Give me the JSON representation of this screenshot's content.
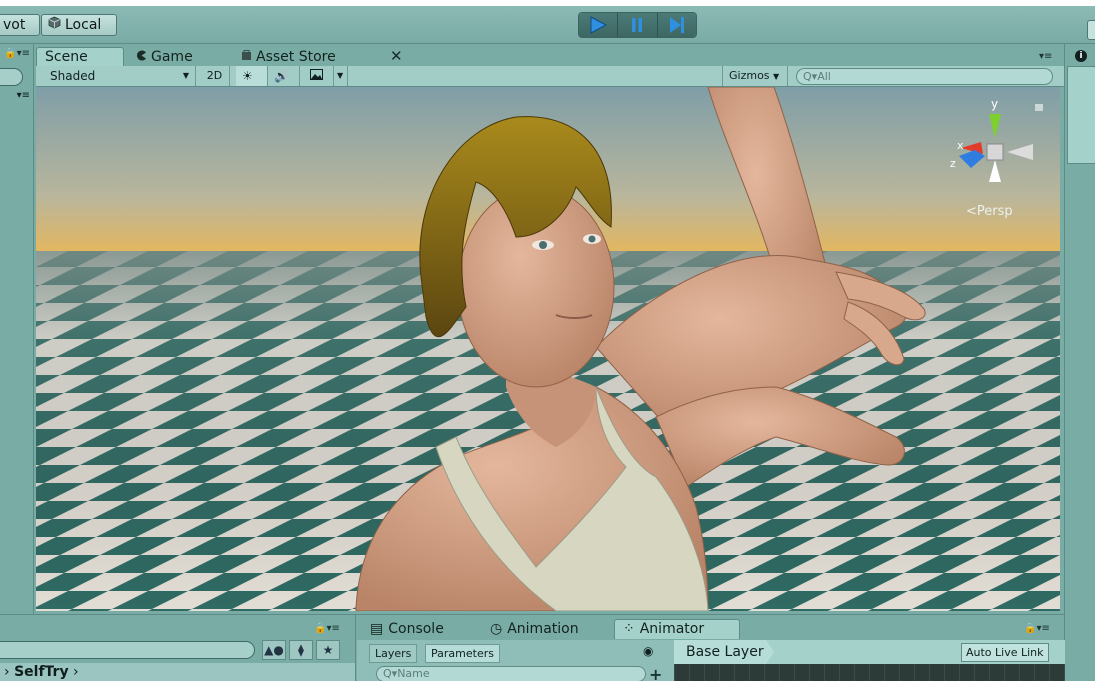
{
  "toolbar": {
    "pivot_label": "vot",
    "local_label": "Local",
    "local_icon": "cube-icon",
    "play_icon": "play-icon",
    "pause_icon": "pause-icon",
    "step_icon": "step-icon"
  },
  "scene_panel": {
    "tabs": [
      {
        "label": "Scene",
        "icon": ""
      },
      {
        "label": "Game",
        "icon": "pacman-icon"
      },
      {
        "label": "Asset Store",
        "icon": "store-icon"
      }
    ],
    "close_glyph": "✕",
    "menu_glyph": "▾≡",
    "toolbar": {
      "shading_mode": "Shaded",
      "mode_2d": "2D",
      "gizmos_label": "Gizmos",
      "search_placeholder": "All"
    },
    "gizmo": {
      "y_label": "y",
      "x_label": "x",
      "z_label": "z",
      "projection": "Persp"
    }
  },
  "hierarchy": {
    "breadcrumb_prefix": "›",
    "breadcrumb_item": "SelfTry",
    "breadcrumb_suffix": "›"
  },
  "bottom_panel": {
    "tabs": [
      {
        "label": "Console",
        "icon": "console-icon"
      },
      {
        "label": "Animation",
        "icon": "clock-icon"
      },
      {
        "label": "Animator",
        "icon": "animator-icon"
      }
    ],
    "sub_tabs": [
      "Layers",
      "Parameters"
    ],
    "name_search_placeholder": "Name",
    "base_layer": "Base Layer",
    "auto_live_link": "Auto Live Link",
    "plus": "+"
  },
  "colors": {
    "panel_bg": "#7aaca6",
    "tab_active": "#a5d1cb",
    "play_blue": "#2f8fe0"
  }
}
